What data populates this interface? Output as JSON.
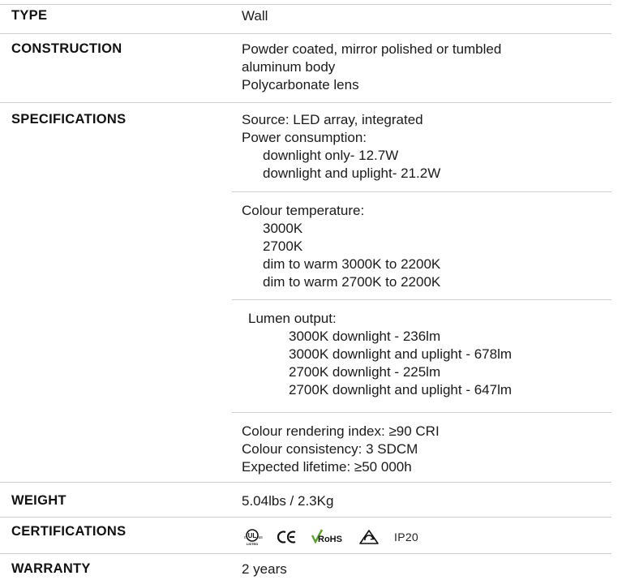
{
  "rows": {
    "type": {
      "label": "TYPE",
      "value": "Wall"
    },
    "construction": {
      "label": "CONSTRUCTION",
      "lines": [
        "Powder coated, mirror polished or tumbled",
        "aluminum body",
        "Polycarbonate lens"
      ]
    },
    "specifications": {
      "label": "SPECIFICATIONS",
      "source": "Source: LED array, integrated",
      "power_title": "Power consumption:",
      "power_items": [
        "downlight only- 12.7W",
        "downlight and uplight- 21.2W"
      ],
      "colour_temp_title": "Colour temperature:",
      "colour_temp_items": [
        "3000K",
        "2700K",
        "dim to warm 3000K to 2200K",
        "dim to warm 2700K to 2200K"
      ],
      "lumen_title": "Lumen output:",
      "lumen_items": [
        "3000K downlight - 236lm",
        "3000K downlight and uplight - 678lm",
        "2700K downlight - 225lm",
        "2700K downlight and uplight - 647lm"
      ],
      "cri": "Colour rendering index: ≥90 CRI",
      "consistency": "Colour consistency: 3 SDCM",
      "lifetime": "Expected lifetime: ≥50 000h"
    },
    "weight": {
      "label": "WEIGHT",
      "value": "5.04lbs / 2.3Kg"
    },
    "certifications": {
      "label": "CERTIFICATIONS",
      "icons": [
        "cul-us-listed-icon",
        "ce-mark-icon",
        "rohs-icon",
        "rcm-icon"
      ],
      "ip_rating": "IP20"
    },
    "warranty": {
      "label": "WARRANTY",
      "value": "2 years"
    }
  }
}
